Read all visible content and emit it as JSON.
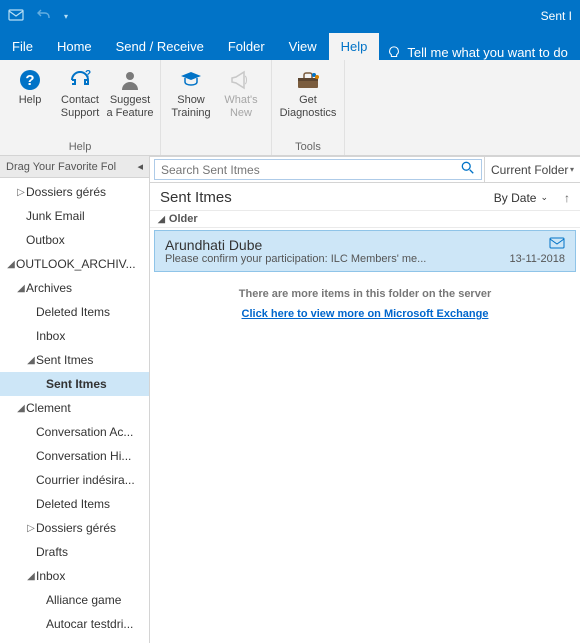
{
  "titlebar": {
    "title": "Sent I"
  },
  "tabs": {
    "file": "File",
    "home": "Home",
    "sendreceive": "Send / Receive",
    "folder": "Folder",
    "view": "View",
    "help": "Help",
    "tellme": "Tell me what you want to do"
  },
  "ribbon": {
    "help": {
      "label": "Help",
      "btns": {
        "help": "Help",
        "contact1": "Contact",
        "contact2": "Support",
        "suggest1": "Suggest",
        "suggest2": "a Feature"
      }
    },
    "training": {
      "btns": {
        "show1": "Show",
        "show2": "Training",
        "whats1": "What's",
        "whats2": "New"
      }
    },
    "tools": {
      "label": "Tools",
      "btns": {
        "get1": "Get",
        "get2": "Diagnostics"
      }
    }
  },
  "nav": {
    "header": "Drag Your Favorite Fol",
    "items": [
      {
        "indent": 1,
        "tw": "▷",
        "label": "Dossiers gérés"
      },
      {
        "indent": 1,
        "tw": "",
        "label": "Junk Email"
      },
      {
        "indent": 1,
        "tw": "",
        "label": "Outbox"
      },
      {
        "indent": 0,
        "tw": "◢",
        "label": "OUTLOOK_ARCHIV..."
      },
      {
        "indent": 1,
        "tw": "◢",
        "label": "Archives"
      },
      {
        "indent": 2,
        "tw": "",
        "label": "Deleted Items"
      },
      {
        "indent": 2,
        "tw": "",
        "label": "Inbox"
      },
      {
        "indent": 2,
        "tw": "◢",
        "label": "Sent Itmes"
      },
      {
        "indent": 3,
        "tw": "",
        "label": "Sent Itmes",
        "bold": true,
        "selected": true
      },
      {
        "indent": 1,
        "tw": "◢",
        "label": "Clement"
      },
      {
        "indent": 2,
        "tw": "",
        "label": "Conversation Ac..."
      },
      {
        "indent": 2,
        "tw": "",
        "label": "Conversation Hi..."
      },
      {
        "indent": 2,
        "tw": "",
        "label": "Courrier indésira..."
      },
      {
        "indent": 2,
        "tw": "",
        "label": "Deleted Items"
      },
      {
        "indent": 2,
        "tw": "▷",
        "label": "Dossiers gérés"
      },
      {
        "indent": 2,
        "tw": "",
        "label": "Drafts"
      },
      {
        "indent": 2,
        "tw": "◢",
        "label": "Inbox"
      },
      {
        "indent": 3,
        "tw": "",
        "label": "Alliance game"
      },
      {
        "indent": 3,
        "tw": "",
        "label": "Autocar testdri..."
      }
    ]
  },
  "mail": {
    "search_placeholder": "Search Sent Itmes",
    "scope": "Current Folder",
    "folder_name": "Sent Itmes",
    "sort_label": "By Date",
    "group": "Older",
    "msg_from": "Arundhati Dube",
    "msg_subject": "Please confirm your participation: ILC Members' me...",
    "msg_date": "13-11-2018",
    "more1": "There are more items in this folder on the server",
    "more2": "Click here to view more on Microsoft Exchange"
  }
}
